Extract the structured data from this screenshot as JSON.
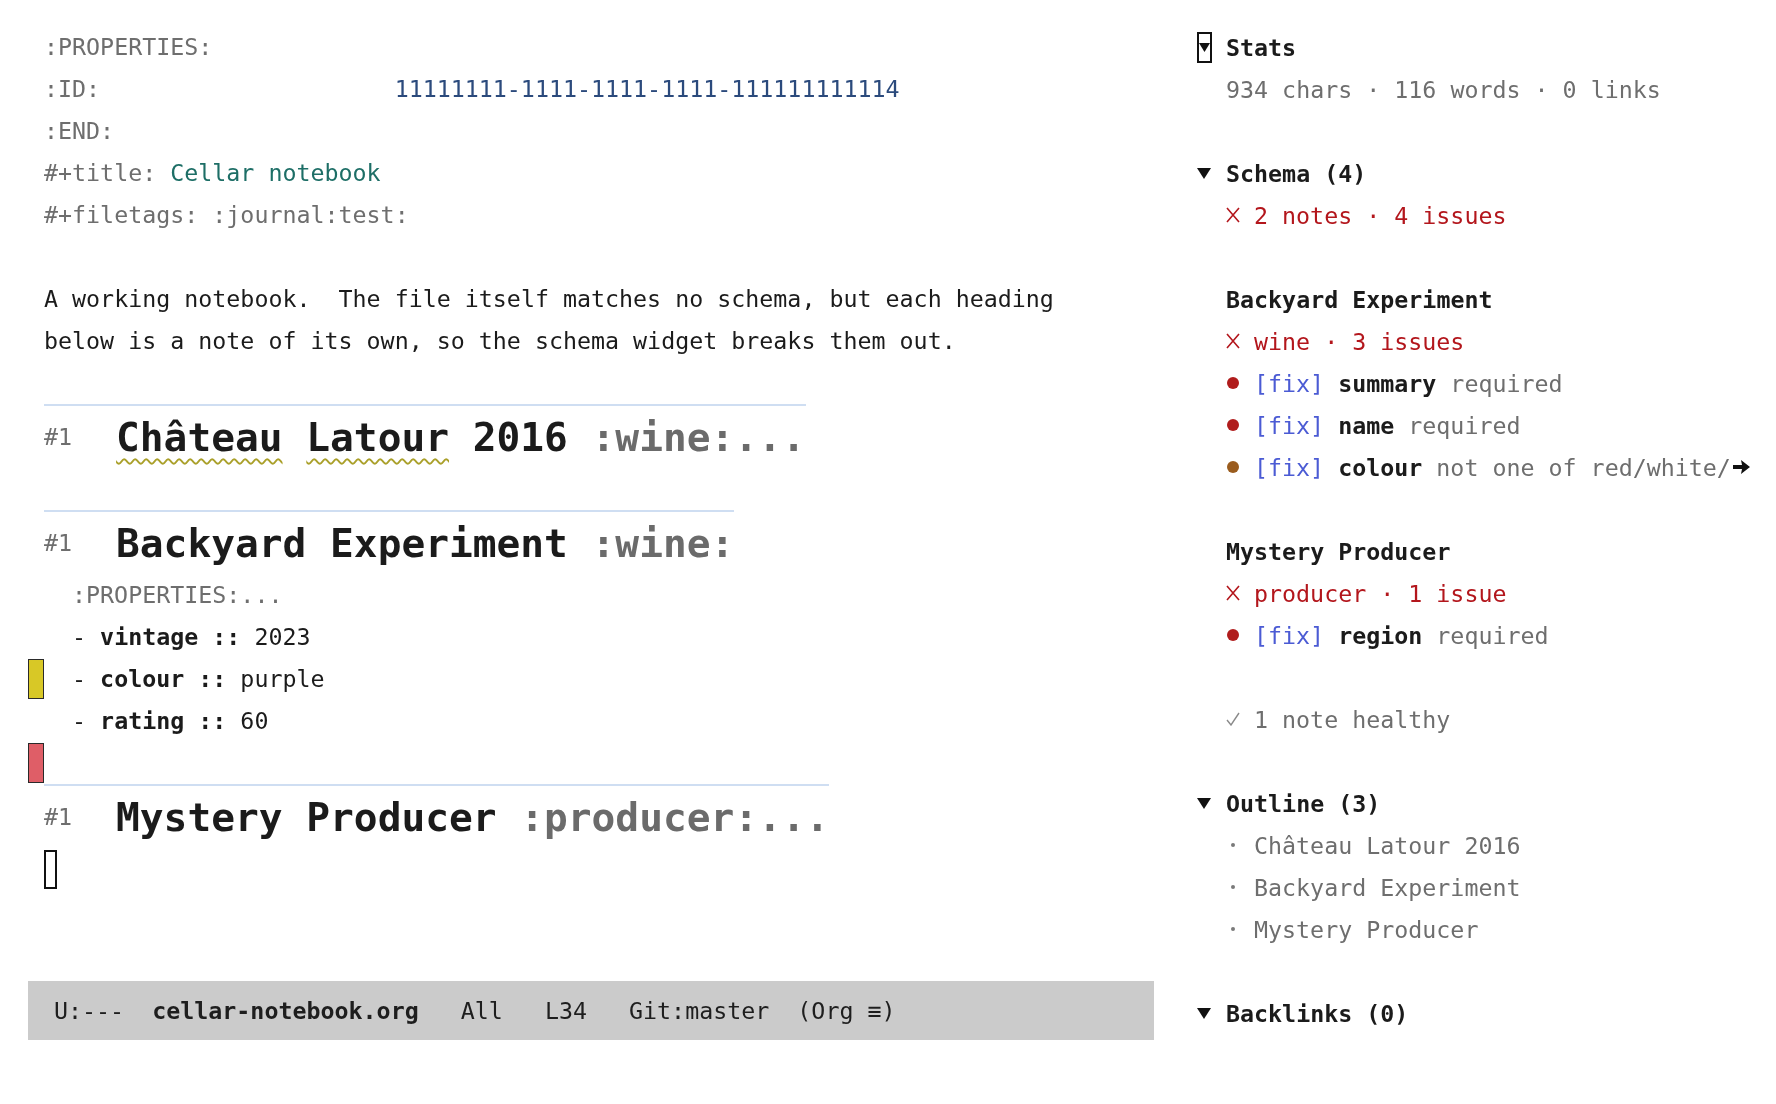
{
  "editor": {
    "lines": [
      {
        "kind": "drawer",
        "text": ":PROPERTIES:"
      },
      {
        "kind": "property",
        "key": ":ID:",
        "value": "11111111-1111-1111-1111-111111111114"
      },
      {
        "kind": "drawer",
        "text": ":END:"
      },
      {
        "kind": "title",
        "key": "#+title:",
        "value": "Cellar notebook"
      },
      {
        "kind": "keyword",
        "key": "#+filetags:",
        "value": ":journal:test:"
      },
      {
        "kind": "blank"
      },
      {
        "kind": "paragraph",
        "text": "A working notebook.  The file itself matches no schema, but each heading\nbelow is a note of its own, so the schema widget breaks them out."
      },
      {
        "kind": "blank"
      },
      {
        "kind": "heading",
        "marker": "#1",
        "words": [
          {
            "text": "Château",
            "misspelled": true
          },
          {
            "text": "Latour",
            "misspelled": true
          },
          {
            "text": "2016",
            "misspelled": false
          }
        ],
        "tags": ":wine:..."
      },
      {
        "kind": "blank"
      },
      {
        "kind": "heading",
        "marker": "#1",
        "words": [
          {
            "text": "Backyard",
            "misspelled": false
          },
          {
            "text": "Experiment",
            "misspelled": false
          }
        ],
        "tags": ":wine:"
      },
      {
        "kind": "folded_drawer",
        "text": ":PROPERTIES:..."
      },
      {
        "kind": "list_item",
        "text": "- **vintage ::** 2023"
      },
      {
        "kind": "list_item",
        "text": "- **colour ::** purple",
        "fringe": {
          "color": "#d8c826"
        }
      },
      {
        "kind": "list_item",
        "text": "- **rating ::** 60"
      },
      {
        "kind": "blank",
        "fringe": {
          "color": "#df5e67"
        }
      },
      {
        "kind": "heading",
        "marker": "#1",
        "words": [
          {
            "text": "Mystery",
            "misspelled": false
          },
          {
            "text": "Producer",
            "misspelled": false
          }
        ],
        "tags": ":producer:..."
      },
      {
        "kind": "cursor"
      }
    ]
  },
  "mode_line": {
    "state": "U:---",
    "buffer": "cellar-notebook.org",
    "position": "All",
    "line": "L34",
    "branch": "Git:master",
    "mode": "(Org ≡)"
  },
  "sidebar": {
    "sections": [
      {
        "kind": "stats",
        "title": "Stats",
        "expanded": true,
        "cursor": true,
        "text": "934 chars · 116 words · 0 links"
      },
      {
        "kind": "schema",
        "title": "Schema (4)",
        "expanded": true,
        "cursor": false,
        "summary": {
          "ok": false,
          "text": "2 notes · 4 issues"
        },
        "notes": [
          {
            "title": "Backyard Experiment",
            "summary": {
              "ok": false,
              "text": "wine · 3 issues"
            },
            "issues": [
              {
                "color": "#b01c1c",
                "action": "[fix]",
                "text": "**summary** required",
                "truncated": false
              },
              {
                "color": "#b01c1c",
                "action": "[fix]",
                "text": "**name** required",
                "truncated": false
              },
              {
                "color": "#9a5c1e",
                "action": "[fix]",
                "text": "**colour** not one of red/white/",
                "truncated": true
              }
            ]
          },
          {
            "title": "Mystery Producer",
            "summary": {
              "ok": false,
              "text": "producer · 1 issue"
            },
            "issues": [
              {
                "color": "#b01c1c",
                "action": "[fix]",
                "text": "**region** required",
                "truncated": false
              }
            ]
          }
        ],
        "healthy": {
          "ok": true,
          "text": "1 note healthy"
        }
      },
      {
        "kind": "outline",
        "title": "Outline (3)",
        "expanded": true,
        "cursor": false,
        "items": [
          "Château Latour 2016",
          "Backyard Experiment",
          "Mystery Producer"
        ]
      },
      {
        "title": "Backlinks (0)",
        "expanded": true,
        "cursor": false
      }
    ]
  }
}
